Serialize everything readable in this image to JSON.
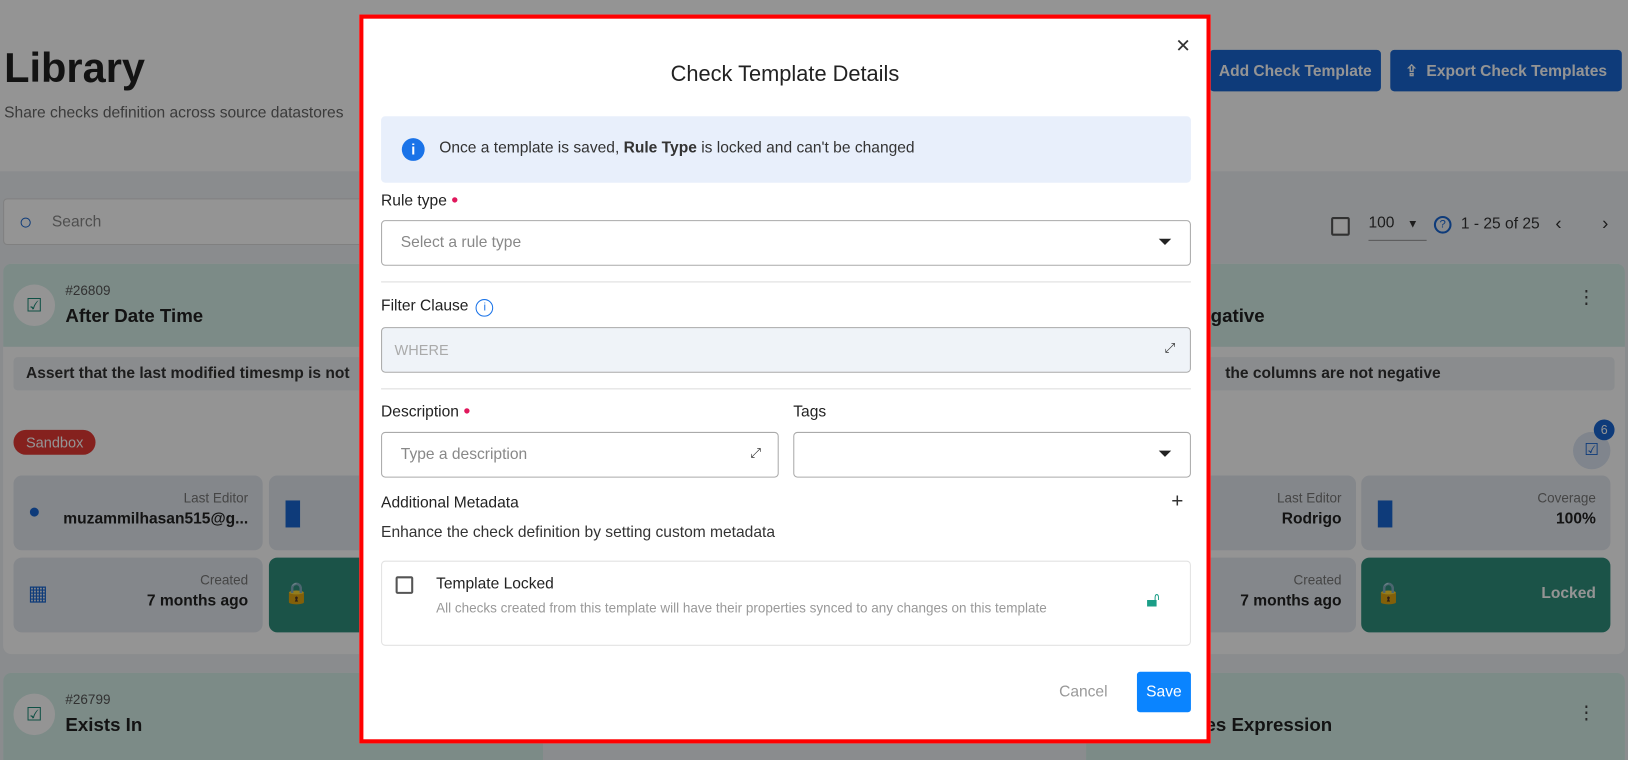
{
  "page": {
    "title": "Library",
    "subtitle": "Share checks definition across source datastores",
    "add_button": "Add Check Template",
    "export_button": "Export Check Templates",
    "search_placeholder": "Search",
    "page_size": "100",
    "range": "1 - 25 of 25"
  },
  "cards": [
    {
      "id": "#26809",
      "name": "After Date Time",
      "description": "Assert that the last modified timesmp is not",
      "badge": "Sandbox",
      "last_editor_label": "Last Editor",
      "last_editor": "muzammilhasan515@g...",
      "created_label": "Created",
      "created": "7 months ago"
    },
    {
      "name": "egative",
      "description": "the columns are not negative",
      "count": "6",
      "last_editor_label": "Last Editor",
      "last_editor": "Rodrigo",
      "coverage_label": "Coverage",
      "coverage": "100%",
      "created_label": "Created",
      "created": "7 months ago",
      "locked": "Locked"
    },
    {
      "id": "#26799",
      "name": "Exists In"
    },
    {
      "name": "ies Expression"
    }
  ],
  "modal": {
    "title": "Check Template Details",
    "info_pre": "Once a template is saved, ",
    "info_bold": "Rule Type",
    "info_post": " is locked and can't be changed",
    "rule_type_label": "Rule type",
    "rule_type_placeholder": "Select a rule type",
    "filter_label": "Filter Clause",
    "filter_placeholder": "WHERE",
    "description_label": "Description",
    "description_placeholder": "Type a description",
    "tags_label": "Tags",
    "metadata_label": "Additional Metadata",
    "metadata_help": "Enhance the check definition by setting custom metadata",
    "locked_label": "Template Locked",
    "locked_help": "All checks created from this template will have their properties synced to any changes on this template",
    "template_locked": false,
    "cancel": "Cancel",
    "save": "Save"
  },
  "colors": {
    "accent": "#1967d2",
    "save": "#0a84ff",
    "highlight_border": "#ff0000",
    "required": "#e0185c",
    "teal": "#1b8a78"
  }
}
